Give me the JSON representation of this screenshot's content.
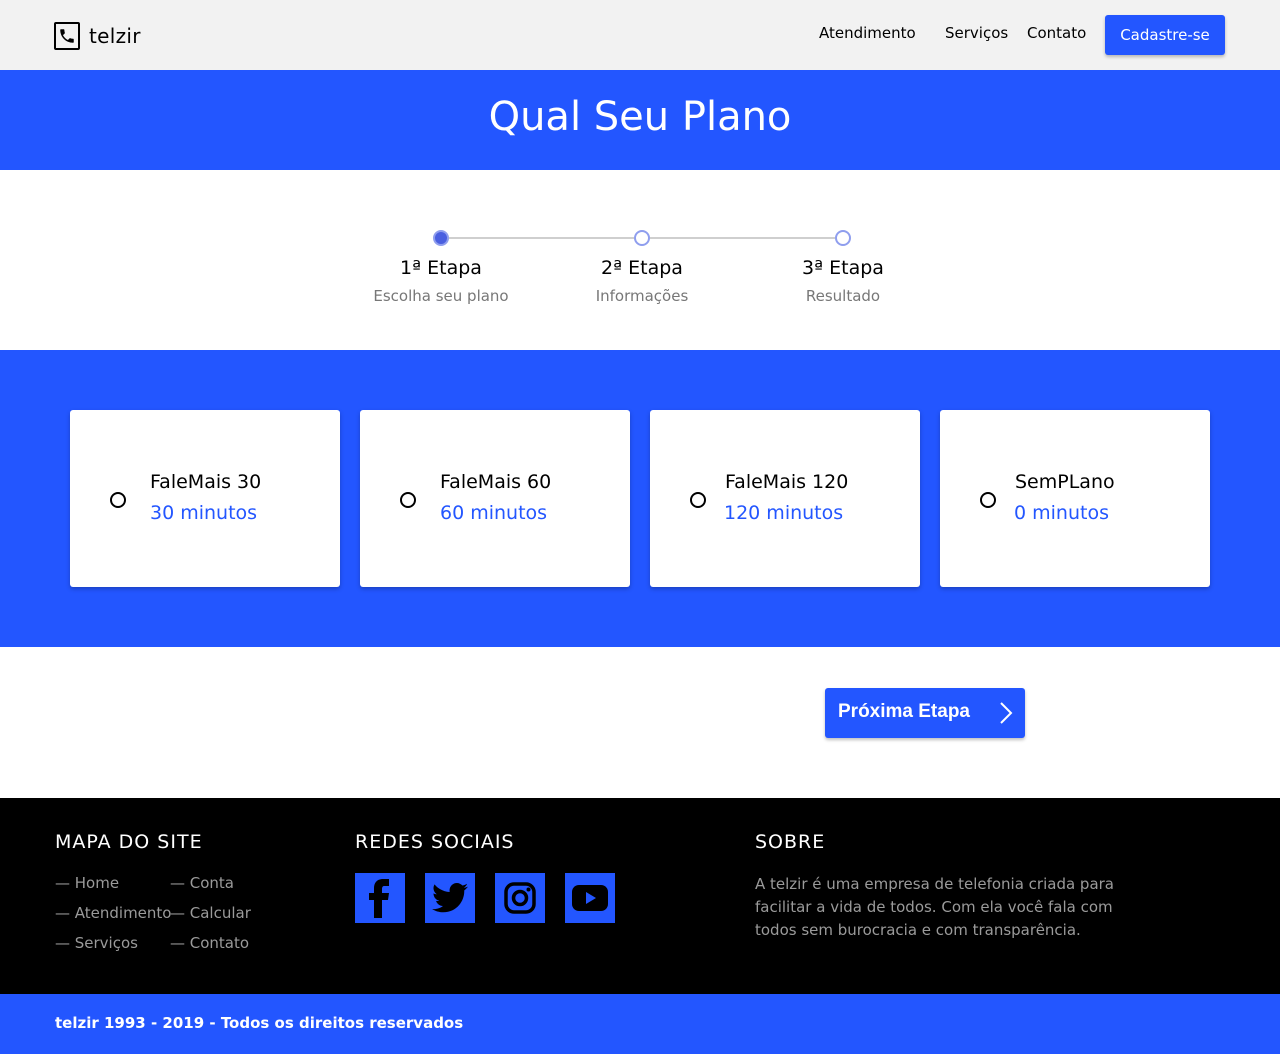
{
  "header": {
    "brand": "telzir",
    "logo_icon": "phone-icon",
    "nav": [
      {
        "label": "Atendimento"
      },
      {
        "label": "Serviços"
      },
      {
        "label": "Contato"
      }
    ],
    "signup_label": "Cadastre-se"
  },
  "hero": {
    "title": "Qual Seu Plano"
  },
  "stepper": {
    "current_step": 1,
    "steps": [
      {
        "title": "1ª Etapa",
        "subtitle": "Escolha seu plano"
      },
      {
        "title": "2ª Etapa",
        "subtitle": "Informações"
      },
      {
        "title": "3ª Etapa",
        "subtitle": "Resultado"
      }
    ]
  },
  "plans": [
    {
      "name": "FaleMais 30",
      "minutes": "30 minutos",
      "selected": false
    },
    {
      "name": "FaleMais 60",
      "minutes": "60 minutos",
      "selected": false
    },
    {
      "name": "FaleMais 120",
      "minutes": "120 minutos",
      "selected": false
    },
    {
      "name": "SemPLano",
      "minutes": "0 minutos",
      "selected": false
    }
  ],
  "next_button": {
    "label": "Próxima Etapa",
    "icon": "chevron-right-icon"
  },
  "footer": {
    "sitemap": {
      "heading": "MAPA DO SITE",
      "links": [
        "— Home",
        "— Atendimento",
        "— Serviços",
        "— Conta",
        "— Calcular",
        "— Contato"
      ]
    },
    "social": {
      "heading": "REDES SOCIAIS",
      "icons": [
        "facebook-icon",
        "twitter-icon",
        "instagram-icon",
        "youtube-icon"
      ]
    },
    "about": {
      "heading": "SOBRE",
      "text": "A telzir é uma empresa de telefonia criada para facilitar a vida de todos. Com ela você fala com todos sem burocracia e com transparência."
    }
  },
  "copyright": "telzir 1993 - 2019 - Todos os direitos reservados",
  "colors": {
    "accent": "#2356ff",
    "header_bg": "#f2f2f2",
    "footer_bg": "#000000",
    "muted_text": "#9a9a9a"
  }
}
